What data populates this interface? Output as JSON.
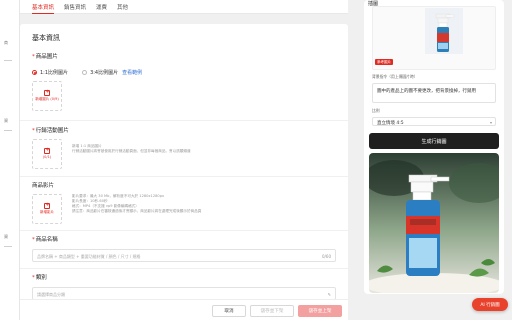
{
  "left_strip": {
    "items": [
      "商",
      "資",
      "資"
    ]
  },
  "tabs": [
    {
      "label": "基本資訊",
      "active": true
    },
    {
      "label": "銷售資訊",
      "active": false
    },
    {
      "label": "運費",
      "active": false
    },
    {
      "label": "其他",
      "active": false
    }
  ],
  "main": {
    "title": "基本資訊",
    "product_image": {
      "label": "商品圖片",
      "radio_1_1": "1:1比例圖片",
      "radio_3_4": "3:4比例圖片",
      "example_link": "查看範例",
      "upload_text": "新增圖片 (0/9)"
    },
    "promo_image": {
      "label": "行銷活動圖片",
      "upload_text": "(0/1)",
      "hints": [
        "新增 1:1 商品圖片",
        "行銷活動圖片將會被使用於行銷活動頁面，但並非每個商品，會以該類頻道"
      ]
    },
    "video": {
      "label": "商品影片",
      "upload_text": "新增影片",
      "hints": [
        "影片要求：最大 30 Mb，解析度不可大於 1280x1280px",
        "影片長度：10秒-60秒",
        "格式：MP4（不支援 vp9 影像編碼格式）",
        "請注意：商品影片在審核通過後才會顯示，商品影片將在處理完成後顯示於商品頁"
      ]
    },
    "name": {
      "label": "商品名稱",
      "placeholder": "品牌名稱 + 商品類型 + 重要功能材質 / 顏色 / 尺寸 / 規格",
      "counter": "0/60"
    },
    "category": {
      "label": "類別",
      "placeholder": "請選擇商品分類"
    }
  },
  "footer": {
    "cancel": "取消",
    "save_unpublish": "儲存並下架",
    "save_publish": "儲存並上架"
  },
  "right_panel": {
    "title": "插圖",
    "thumb_badge": "參考圖片",
    "prompt_label": "背景指令（用上傳圖片時）",
    "prompt_value": "圖中的產品上的圖不要更改，把背景換掉，行銷用",
    "ratio_label": "比例",
    "ratio_value": "直立情境 4:5",
    "generate_button": "生成行銷圖"
  },
  "ai_fab": "AI 行銷圖",
  "colors": {
    "accent": "#e02a22",
    "dark_button": "#1f1f1f",
    "link": "#2f6fd6"
  }
}
